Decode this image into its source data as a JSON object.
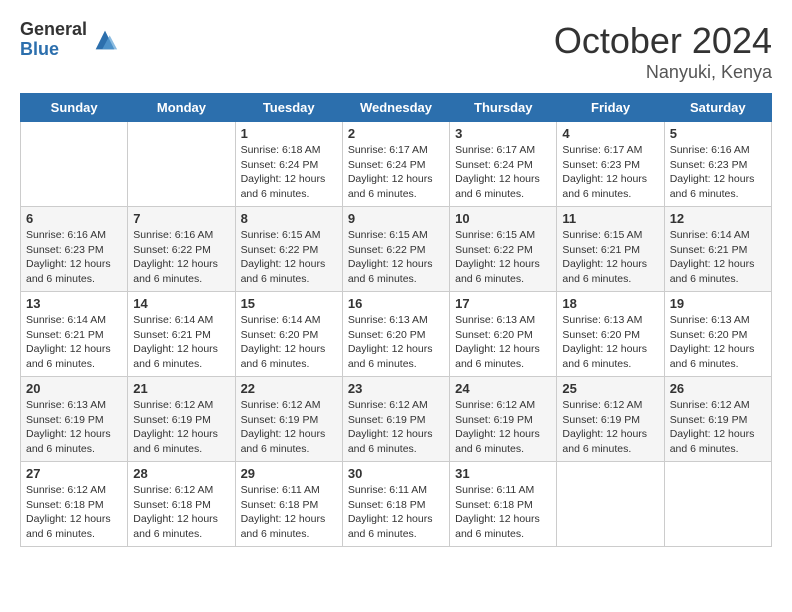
{
  "logo": {
    "general": "General",
    "blue": "Blue"
  },
  "title": {
    "month": "October 2024",
    "location": "Nanyuki, Kenya"
  },
  "weekdays": [
    "Sunday",
    "Monday",
    "Tuesday",
    "Wednesday",
    "Thursday",
    "Friday",
    "Saturday"
  ],
  "weeks": [
    [
      {
        "day": "",
        "info": ""
      },
      {
        "day": "",
        "info": ""
      },
      {
        "day": "1",
        "info": "Sunrise: 6:18 AM\nSunset: 6:24 PM\nDaylight: 12 hours and 6 minutes."
      },
      {
        "day": "2",
        "info": "Sunrise: 6:17 AM\nSunset: 6:24 PM\nDaylight: 12 hours and 6 minutes."
      },
      {
        "day": "3",
        "info": "Sunrise: 6:17 AM\nSunset: 6:24 PM\nDaylight: 12 hours and 6 minutes."
      },
      {
        "day": "4",
        "info": "Sunrise: 6:17 AM\nSunset: 6:23 PM\nDaylight: 12 hours and 6 minutes."
      },
      {
        "day": "5",
        "info": "Sunrise: 6:16 AM\nSunset: 6:23 PM\nDaylight: 12 hours and 6 minutes."
      }
    ],
    [
      {
        "day": "6",
        "info": "Sunrise: 6:16 AM\nSunset: 6:23 PM\nDaylight: 12 hours and 6 minutes."
      },
      {
        "day": "7",
        "info": "Sunrise: 6:16 AM\nSunset: 6:22 PM\nDaylight: 12 hours and 6 minutes."
      },
      {
        "day": "8",
        "info": "Sunrise: 6:15 AM\nSunset: 6:22 PM\nDaylight: 12 hours and 6 minutes."
      },
      {
        "day": "9",
        "info": "Sunrise: 6:15 AM\nSunset: 6:22 PM\nDaylight: 12 hours and 6 minutes."
      },
      {
        "day": "10",
        "info": "Sunrise: 6:15 AM\nSunset: 6:22 PM\nDaylight: 12 hours and 6 minutes."
      },
      {
        "day": "11",
        "info": "Sunrise: 6:15 AM\nSunset: 6:21 PM\nDaylight: 12 hours and 6 minutes."
      },
      {
        "day": "12",
        "info": "Sunrise: 6:14 AM\nSunset: 6:21 PM\nDaylight: 12 hours and 6 minutes."
      }
    ],
    [
      {
        "day": "13",
        "info": "Sunrise: 6:14 AM\nSunset: 6:21 PM\nDaylight: 12 hours and 6 minutes."
      },
      {
        "day": "14",
        "info": "Sunrise: 6:14 AM\nSunset: 6:21 PM\nDaylight: 12 hours and 6 minutes."
      },
      {
        "day": "15",
        "info": "Sunrise: 6:14 AM\nSunset: 6:20 PM\nDaylight: 12 hours and 6 minutes."
      },
      {
        "day": "16",
        "info": "Sunrise: 6:13 AM\nSunset: 6:20 PM\nDaylight: 12 hours and 6 minutes."
      },
      {
        "day": "17",
        "info": "Sunrise: 6:13 AM\nSunset: 6:20 PM\nDaylight: 12 hours and 6 minutes."
      },
      {
        "day": "18",
        "info": "Sunrise: 6:13 AM\nSunset: 6:20 PM\nDaylight: 12 hours and 6 minutes."
      },
      {
        "day": "19",
        "info": "Sunrise: 6:13 AM\nSunset: 6:20 PM\nDaylight: 12 hours and 6 minutes."
      }
    ],
    [
      {
        "day": "20",
        "info": "Sunrise: 6:13 AM\nSunset: 6:19 PM\nDaylight: 12 hours and 6 minutes."
      },
      {
        "day": "21",
        "info": "Sunrise: 6:12 AM\nSunset: 6:19 PM\nDaylight: 12 hours and 6 minutes."
      },
      {
        "day": "22",
        "info": "Sunrise: 6:12 AM\nSunset: 6:19 PM\nDaylight: 12 hours and 6 minutes."
      },
      {
        "day": "23",
        "info": "Sunrise: 6:12 AM\nSunset: 6:19 PM\nDaylight: 12 hours and 6 minutes."
      },
      {
        "day": "24",
        "info": "Sunrise: 6:12 AM\nSunset: 6:19 PM\nDaylight: 12 hours and 6 minutes."
      },
      {
        "day": "25",
        "info": "Sunrise: 6:12 AM\nSunset: 6:19 PM\nDaylight: 12 hours and 6 minutes."
      },
      {
        "day": "26",
        "info": "Sunrise: 6:12 AM\nSunset: 6:19 PM\nDaylight: 12 hours and 6 minutes."
      }
    ],
    [
      {
        "day": "27",
        "info": "Sunrise: 6:12 AM\nSunset: 6:18 PM\nDaylight: 12 hours and 6 minutes."
      },
      {
        "day": "28",
        "info": "Sunrise: 6:12 AM\nSunset: 6:18 PM\nDaylight: 12 hours and 6 minutes."
      },
      {
        "day": "29",
        "info": "Sunrise: 6:11 AM\nSunset: 6:18 PM\nDaylight: 12 hours and 6 minutes."
      },
      {
        "day": "30",
        "info": "Sunrise: 6:11 AM\nSunset: 6:18 PM\nDaylight: 12 hours and 6 minutes."
      },
      {
        "day": "31",
        "info": "Sunrise: 6:11 AM\nSunset: 6:18 PM\nDaylight: 12 hours and 6 minutes."
      },
      {
        "day": "",
        "info": ""
      },
      {
        "day": "",
        "info": ""
      }
    ]
  ]
}
